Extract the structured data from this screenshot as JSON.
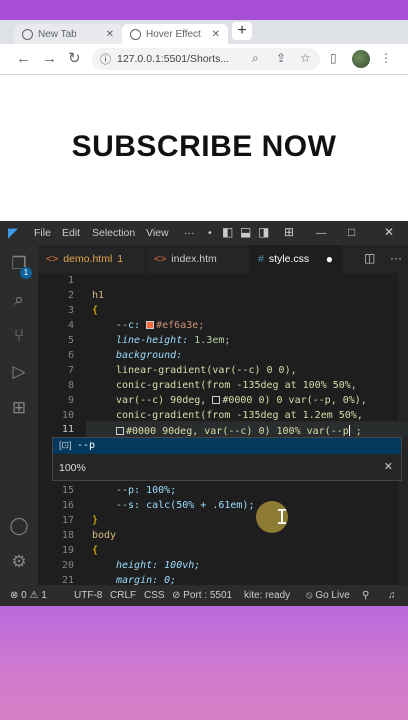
{
  "browser": {
    "tabs": [
      {
        "label": "New Tab"
      },
      {
        "label": "Hover Effect"
      }
    ],
    "url": "127.0.0.1:5501/Shorts..."
  },
  "page": {
    "heading": "SUBSCRIBE NOW"
  },
  "vscode": {
    "menu": [
      "File",
      "Edit",
      "Selection",
      "View",
      "···"
    ],
    "editor_tabs": [
      {
        "label": "demo.html",
        "badge": "1",
        "color": "#e2a74f"
      },
      {
        "label": "index.htm",
        "color": "#cccccc"
      },
      {
        "label": "style.css",
        "color": "#ffffff"
      }
    ],
    "line_numbers": [
      "1",
      "2",
      "3",
      "4",
      "5",
      "6",
      "7",
      "8",
      "9",
      "10",
      "11",
      "15",
      "16",
      "17",
      "18",
      "19",
      "20",
      "21"
    ],
    "code": {
      "l3": "h1",
      "l4_open": "{",
      "l4_prop": "--c: ",
      "l4_val": "#ef6a3e;",
      "l5_prop": "line-height: ",
      "l5_val": "1.3em;",
      "l6": "background:",
      "l7": "linear-gradient(var(--c) 0 0),",
      "l8": "conic-gradient(from -135deg at 100% 50%,",
      "l9": "var(--c) 90deg, ",
      "l9b": "#0000 0) 0 var(--p, 0%),",
      "l10": "conic-gradient(from -135deg at 1.2em 50%,",
      "l11": "#0000 90deg, var(--c) 0) 100% var(--p",
      "l11_end": " ;",
      "l15": "--p: 100%;",
      "l16": "--s: calc(50% + .61em);",
      "l17": "}",
      "l18": "body",
      "l19": "{",
      "l20": "height: 100vh;",
      "l21": "margin: 0;"
    },
    "suggest": {
      "item": "--p",
      "detail": "100%"
    },
    "status": {
      "problems": "0",
      "warnings": "1",
      "encoding": "UTF-8",
      "eol": "CRLF",
      "lang": "CSS",
      "port": "Port : 5501",
      "kite": "kite: ready",
      "golive": "Go Live"
    },
    "swatch_color": "#ef6a3e"
  }
}
